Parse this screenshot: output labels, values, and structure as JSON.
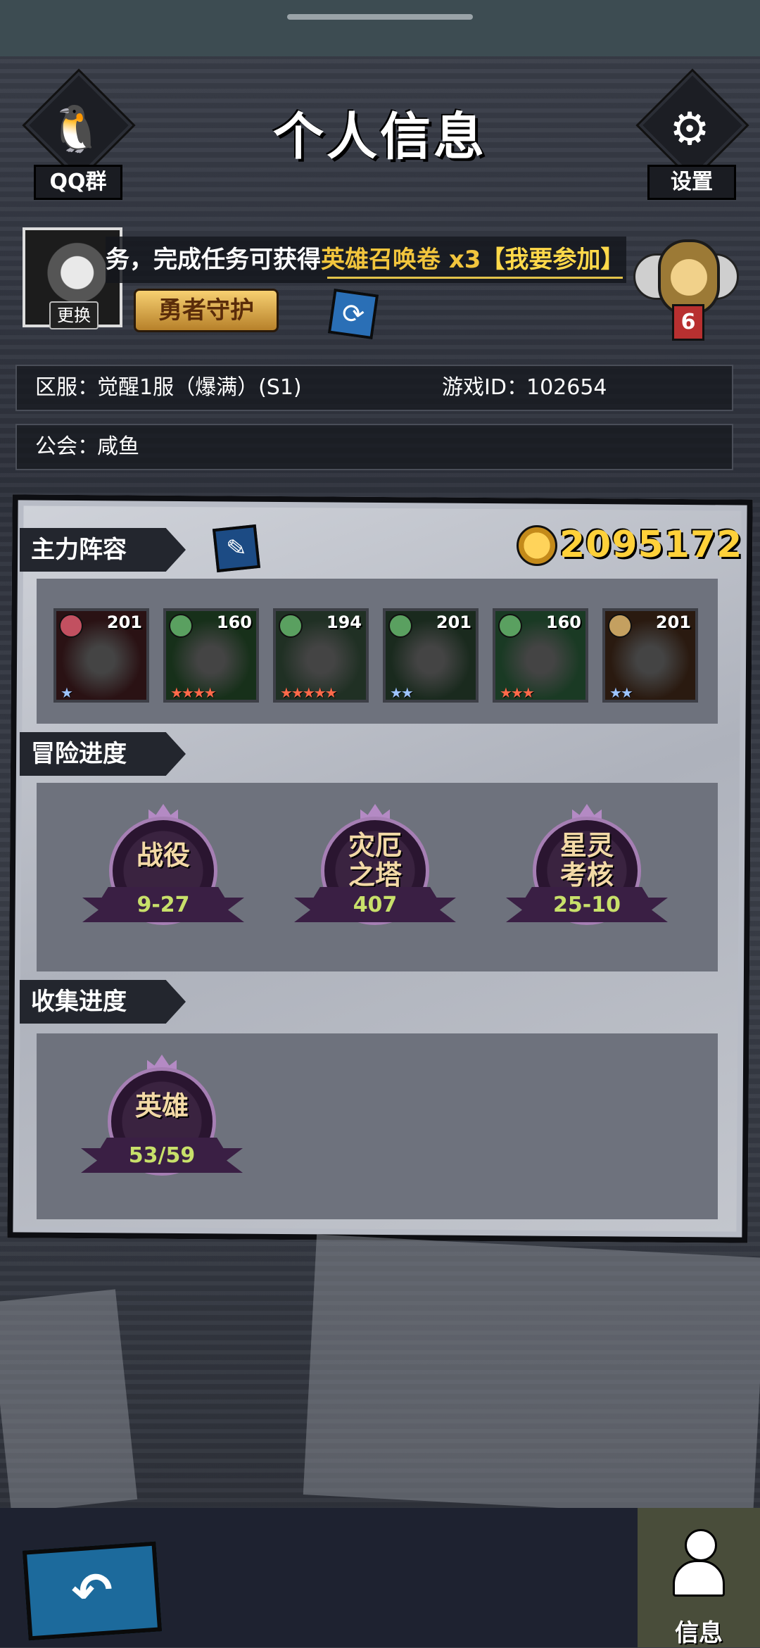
{
  "header": {
    "title": "个人信息",
    "qq_group_label": "QQ群",
    "settings_label": "设置"
  },
  "profile": {
    "avatar_change_label": "更换",
    "notice_prefix": "务，完成任务可获得",
    "notice_reward": "英雄召唤卷 x3",
    "notice_link": "【我要参加】",
    "badge_label": "勇者守护",
    "rank_level": "6"
  },
  "info": {
    "server_label": "区服：",
    "server_value": "觉醒1服（爆满）(S1)",
    "game_id_label": "游戏ID：",
    "game_id_value": "102654",
    "guild_label": "公会：",
    "guild_value": "咸鱼"
  },
  "lineup": {
    "section_label": "主力阵容",
    "power": "2095172",
    "heroes": [
      {
        "level": "201",
        "stars": "★",
        "star_color": "#9ec4ff",
        "element": "#c25060",
        "bg": "#2a1214"
      },
      {
        "level": "160",
        "stars": "★★★★",
        "star_color": "#ff6a4a",
        "element": "#5aa060",
        "bg": "#17301a"
      },
      {
        "level": "194",
        "stars": "★★★★★",
        "star_color": "#ff6a4a",
        "element": "#5aa060",
        "bg": "#203024"
      },
      {
        "level": "201",
        "stars": "★★",
        "star_color": "#9ec4ff",
        "element": "#5aa060",
        "bg": "#1a2a1e"
      },
      {
        "level": "160",
        "stars": "★★★",
        "star_color": "#ff6a4a",
        "element": "#5aa060",
        "bg": "#1a3a24"
      },
      {
        "level": "201",
        "stars": "★★",
        "star_color": "#9ec4ff",
        "element": "#c4a060",
        "bg": "#2a1a10"
      }
    ]
  },
  "adventure": {
    "section_label": "冒险进度",
    "items": [
      {
        "name": "战役",
        "value": "9-27"
      },
      {
        "name": "灾厄之塔",
        "value": "407"
      },
      {
        "name": "星灵考核",
        "value": "25-10"
      }
    ]
  },
  "collection": {
    "section_label": "收集进度",
    "items": [
      {
        "name": "英雄",
        "value": "53/59"
      }
    ]
  },
  "bottom_nav": {
    "back_icon": "back-arrow-icon",
    "info_label": "信息"
  }
}
